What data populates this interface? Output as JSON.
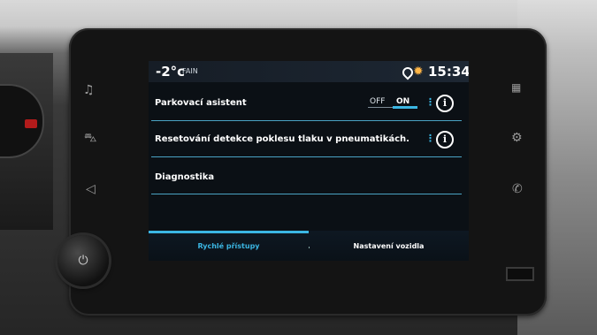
{
  "status_bar": {
    "temperature": "-2°c",
    "profile": "FAIN",
    "time": "15:34",
    "icons": [
      "location-pin-icon",
      "gear-icon"
    ]
  },
  "settings": {
    "items": [
      {
        "label": "Parkovací asistent",
        "toggle": {
          "off_label": "OFF",
          "on_label": "ON",
          "value": "ON"
        }
      },
      {
        "label": "Resetování detekce poklesu tlaku v pneumatikách."
      },
      {
        "label": "Diagnostika"
      }
    ],
    "dots": "⋮",
    "info_glyph": "i"
  },
  "tabs": [
    {
      "label": "Rychlé přístupy",
      "active": true
    },
    {
      "label": "Nastavení vozidla",
      "active": false
    }
  ],
  "hardware": {
    "left_buttons": [
      "music-icon",
      "car-icon",
      "navigation-icon"
    ],
    "right_buttons": [
      "apps-grid-icon",
      "settings-icon",
      "phone-icon"
    ],
    "power_glyph": "⏻"
  },
  "colors": {
    "accent": "#3bb6e3",
    "gear": "#ffb545"
  }
}
